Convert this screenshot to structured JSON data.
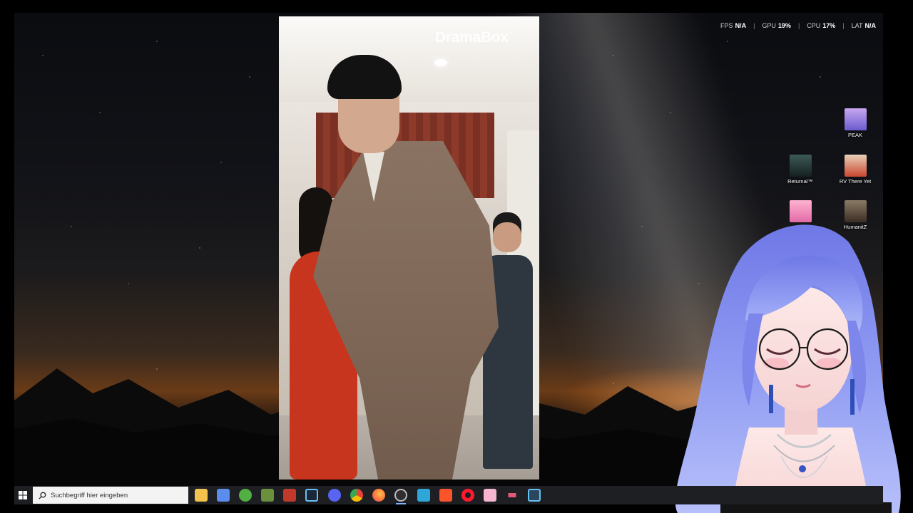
{
  "overlay": {
    "fps_label": "FPS",
    "fps_value": "N/A",
    "gpu_label": "GPU",
    "gpu_value": "19%",
    "cpu_label": "CPU",
    "cpu_value": "17%",
    "lat_label": "LAT",
    "lat_value": "N/A"
  },
  "video": {
    "watermark": "DramaBox"
  },
  "desktop_icons": [
    {
      "label": "PEAK",
      "icon": "peak-game-icon",
      "color": "#7c6cd8"
    },
    {
      "label": "Returnal™",
      "icon": "returnal-game-icon",
      "color": "#2a3a3c"
    },
    {
      "label": "RV There Yet",
      "icon": "rv-there-yet-game-icon",
      "color": "#c9472f"
    },
    {
      "label": "",
      "icon": "pink-game-icon",
      "color": "#e26aa8"
    },
    {
      "label": "HumanitZ",
      "icon": "humanitz-game-icon",
      "color": "#4a3a2a"
    }
  ],
  "taskbar": {
    "search_placeholder": "Suchbegriff hier eingeben",
    "apps": [
      {
        "name": "file-explorer-icon",
        "color": "#f2c14e"
      },
      {
        "name": "store-icon",
        "color": "#5b8def"
      },
      {
        "name": "xbox-icon",
        "color": "#52b043"
      },
      {
        "name": "minecraft-icon",
        "color": "#6a8f3d"
      },
      {
        "name": "game-launcher-icon",
        "color": "#c0392b"
      },
      {
        "name": "steam-icon",
        "color": "#1b2838"
      },
      {
        "name": "discord-icon",
        "color": "#5865f2"
      },
      {
        "name": "chrome-icon",
        "color": "#e8a33d"
      },
      {
        "name": "firefox-icon",
        "color": "#ff7139"
      },
      {
        "name": "obs-icon",
        "color": "#302e31"
      },
      {
        "name": "tool-icon",
        "color": "#2ea6d9"
      },
      {
        "name": "brave-icon",
        "color": "#fb542b"
      },
      {
        "name": "opera-icon",
        "color": "#ff1b2d"
      },
      {
        "name": "pink-app-icon",
        "color": "#f7b5cf"
      },
      {
        "name": "pen-tool-icon",
        "color": "#e15a7a"
      },
      {
        "name": "steam-alt-icon",
        "color": "#66c0f4"
      }
    ]
  }
}
